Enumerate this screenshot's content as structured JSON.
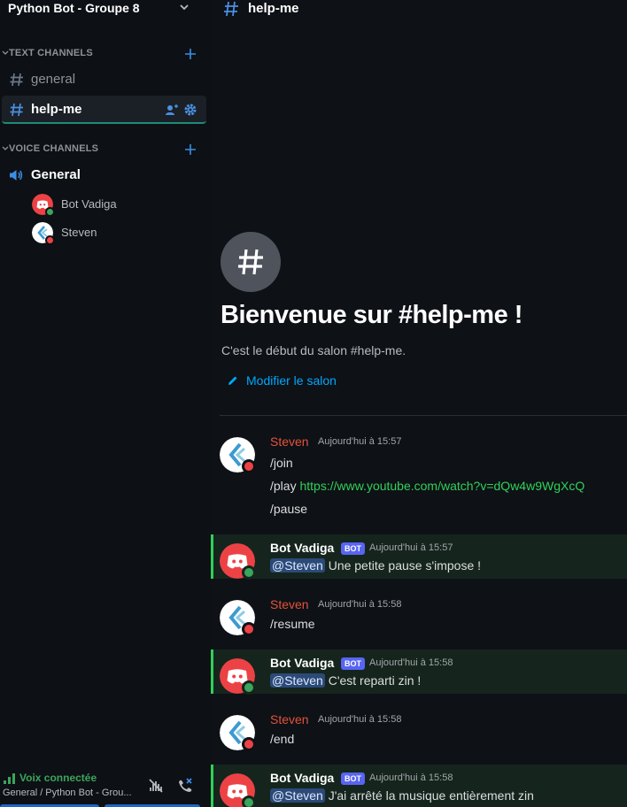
{
  "server": {
    "name": "Python Bot - Groupe 8"
  },
  "categories": {
    "text": "TEXT CHANNELS",
    "voice": "VOICE CHANNELS"
  },
  "text_channels": [
    {
      "name": "general",
      "active": false
    },
    {
      "name": "help-me",
      "active": true
    }
  ],
  "voice_channel": {
    "name": "General"
  },
  "voice_users": [
    {
      "name": "Bot Vadiga",
      "avatar": "discord-bot-avatar"
    },
    {
      "name": "Steven",
      "avatar": "steven-avatar"
    }
  ],
  "voice_panel": {
    "status": "Voix connectée",
    "location": "General / Python Bot - Grou..."
  },
  "topbar": {
    "channel": "help-me"
  },
  "welcome": {
    "title": "Bienvenue sur #help-me !",
    "subtitle": "C'est le début du salon #help-me.",
    "edit_label": "Modifier le salon"
  },
  "messages": [
    {
      "author": "Steven",
      "time": "Aujourd'hui à 15:57",
      "lines": [
        "/join",
        "/play ",
        "/pause"
      ],
      "link": "https://www.youtube.com/watch?v=dQw4w9WgXcQ"
    },
    {
      "author": "Bot Vadiga",
      "tag": "BOT",
      "time": "Aujourd'hui à 15:57",
      "mention": "@Steven",
      "text": " Une petite pause s'impose !"
    },
    {
      "author": "Steven",
      "time": "Aujourd'hui à 15:58",
      "text": "/resume"
    },
    {
      "author": "Bot Vadiga",
      "tag": "BOT",
      "time": "Aujourd'hui à 15:58",
      "mention": "@Steven",
      "text": " C'est reparti zin !"
    },
    {
      "author": "Steven",
      "time": "Aujourd'hui à 15:58",
      "text": "/end"
    },
    {
      "author": "Bot Vadiga",
      "tag": "BOT",
      "time": "Aujourd'hui à 15:58",
      "mention": "@Steven",
      "text": " J'ai arrêté la musique entièrement zin"
    }
  ],
  "colors": {
    "accent_green": "#30d158",
    "link_blue": "#00a8fc",
    "steven_red": "#e2523c",
    "bot_blurple": "#5865f2",
    "status_online": "#3ba55c",
    "status_dnd": "#ed4245"
  }
}
